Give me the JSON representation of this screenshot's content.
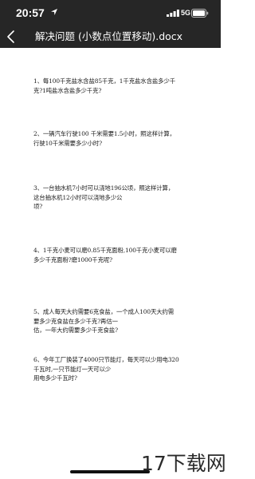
{
  "status_bar": {
    "time": "20:57",
    "network": "5G",
    "icons": [
      "location-arrow-icon",
      "signal-bars-icon",
      "battery-icon"
    ]
  },
  "nav_bar": {
    "back_icon": "chevron-left-icon",
    "title": "解决问题 (小数点位置移动).docx"
  },
  "questions": [
    {
      "lines": [
        "1、每100千克盐水含盐85千克，1千克盐水含盐多少千",
        "克?1吨盐水含盐多少千克?"
      ]
    },
    {
      "lines": [
        "2、一辆汽车行驶100 千米需要1.5小时，照这样计算，",
        "行驶10千米需要多少小时?"
      ]
    },
    {
      "lines": [
        "3、一台抽水机7小时可以浇地196公顷，照这样计算，",
        "这台抽水机12小时可以浇地多少公",
        "顷?"
      ]
    },
    {
      "lines": [
        "4、1千克小麦可以磨0.85千克面粉,100千克小麦可以磨",
        "多少千克面粉?磨1000千克呢?"
      ]
    },
    {
      "lines": [
        "5、成人每天大约需要6克食盐，一个成人100天大约需",
        "要多少克食盐在多少千克?再估一",
        "估，一年大约需要多少千克食盐?"
      ]
    },
    {
      "lines": [
        "6、今年工厂换装了4000只节能灯，每天可以少用电320",
        "千瓦时,一只节能灯一天可以少",
        "用电多少千瓦时?"
      ]
    }
  ],
  "watermark": "17下载网",
  "colors": {
    "bar_background": "#262626",
    "page_background": "#ffffff",
    "text": "#1a1a1a"
  }
}
